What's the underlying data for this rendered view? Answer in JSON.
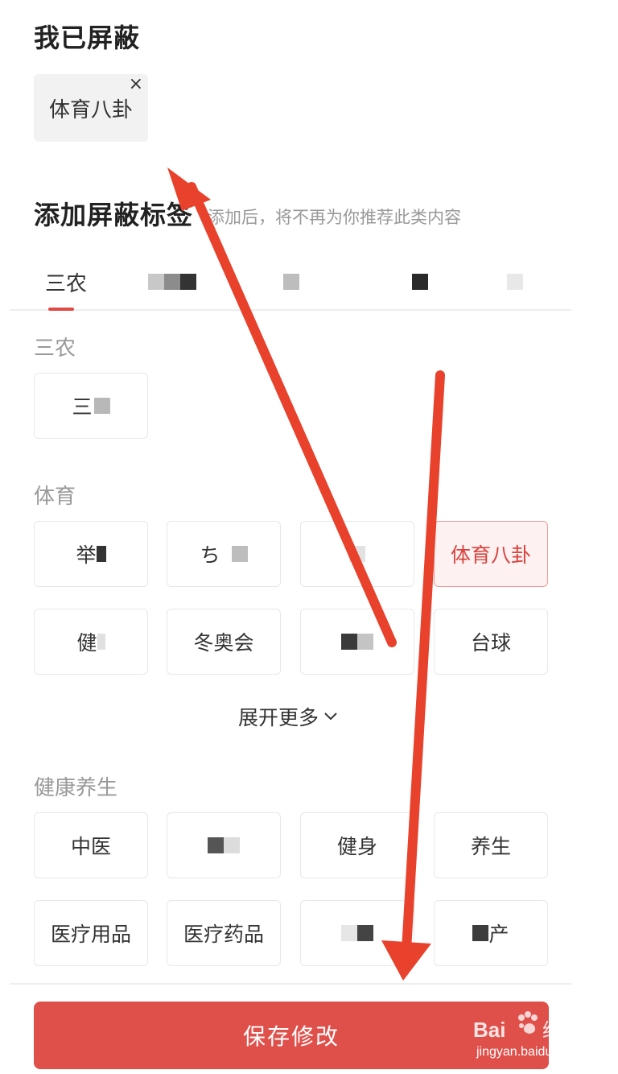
{
  "blocked": {
    "title": "我已屏蔽",
    "tags": [
      {
        "label": "体育八卦",
        "close_icon": "×"
      }
    ]
  },
  "add": {
    "title": "添加屏蔽标签",
    "hint": "添加后，将不再为你推荐此类内容"
  },
  "tabs": [
    {
      "label": "三农",
      "active": true
    },
    {
      "label": ""
    },
    {
      "label": ""
    },
    {
      "label": ""
    },
    {
      "label": ""
    }
  ],
  "categories": {
    "sannong": {
      "label": "三农",
      "chips": [
        {
          "label": "三"
        }
      ]
    },
    "sports": {
      "label": "体育",
      "chips": [
        {
          "label": "举"
        },
        {
          "label": "ち"
        },
        {
          "label": ""
        },
        {
          "label": "体育八卦",
          "selected": true
        },
        {
          "label": "健"
        },
        {
          "label": "冬奥会"
        },
        {
          "label": ""
        },
        {
          "label": "台球"
        }
      ],
      "show_more": "展开更多"
    },
    "health": {
      "label": "健康养生",
      "chips": [
        {
          "label": "中医"
        },
        {
          "label": ""
        },
        {
          "label": "健身"
        },
        {
          "label": "养生"
        },
        {
          "label": "医疗用品"
        },
        {
          "label": "医疗药品"
        },
        {
          "label": ""
        },
        {
          "label": "产"
        }
      ]
    }
  },
  "save_button": "保存修改",
  "watermark": {
    "brand": "Baidu经验",
    "url": "jingyan.baidu.com"
  },
  "colors": {
    "accent": "#e0504b",
    "selected_bg": "#fdf1f1",
    "selected_text": "#d9433e",
    "annotation_arrow": "#e8412c"
  }
}
